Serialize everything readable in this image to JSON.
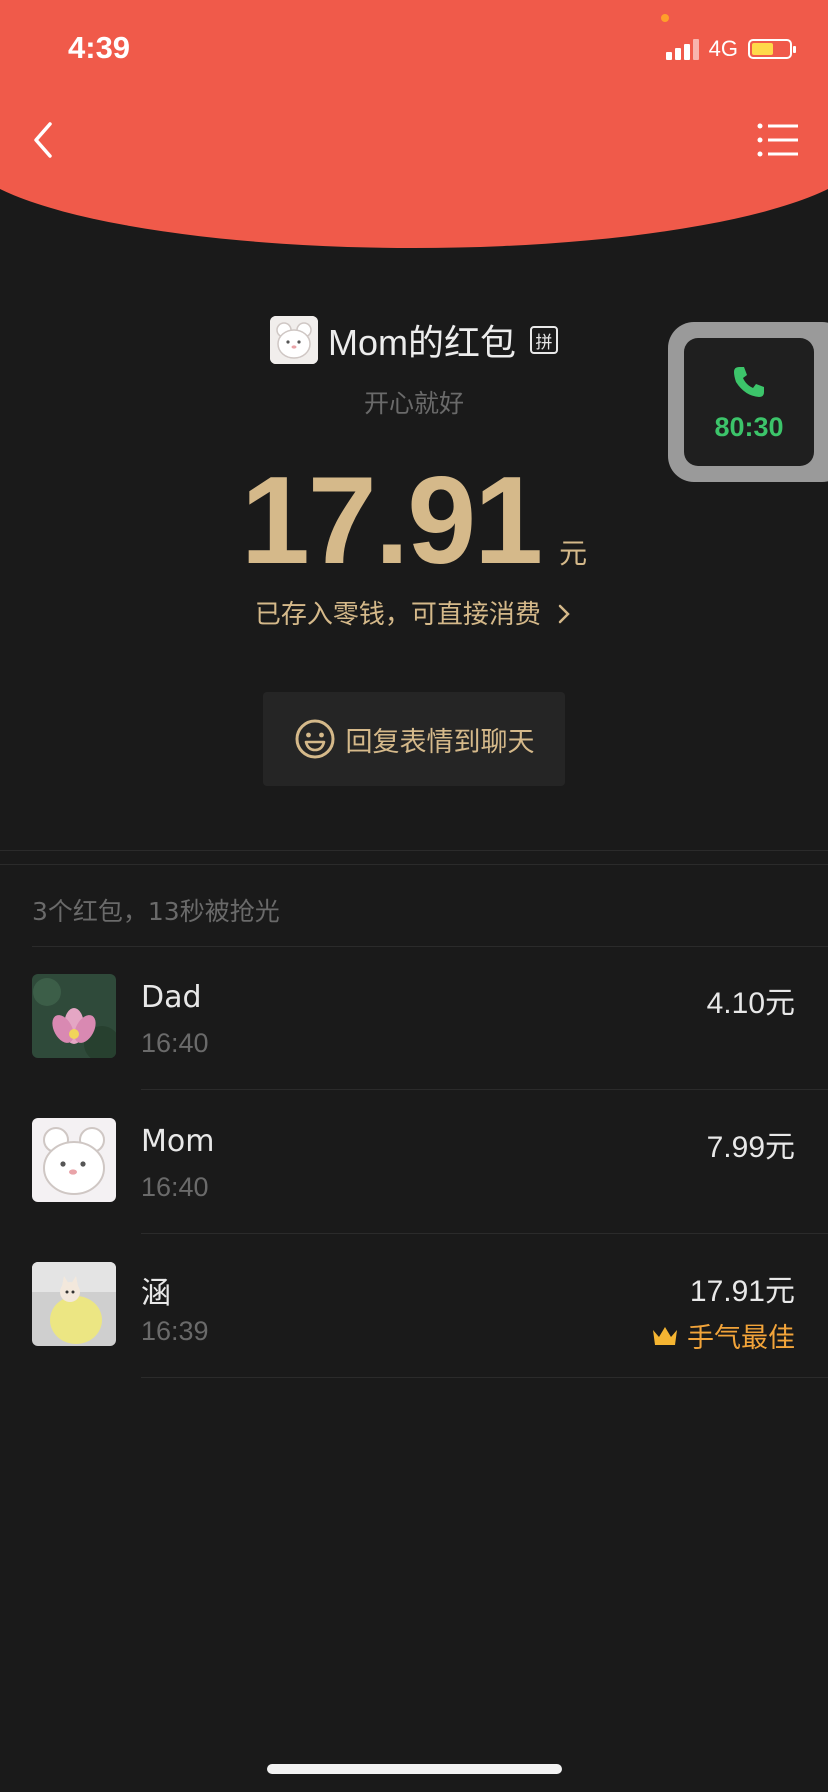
{
  "status": {
    "time": "4:39",
    "network": "4G",
    "battery_level": 0.52
  },
  "nav": {
    "back_icon": "chevron-left-icon",
    "menu_icon": "list-icon"
  },
  "packet": {
    "sender": "Mom的红包",
    "type_badge": "拼",
    "greeting": "开心就好",
    "amount": "17.91",
    "unit": "元",
    "saved_note": "已存入零钱，可直接消费",
    "reply_label": "回复表情到聊天"
  },
  "call_widget": {
    "duration": "80:30",
    "icon": "phone-icon",
    "color": "#3cc46a"
  },
  "summary": "3个红包，13秒被抢光",
  "recipients": [
    {
      "name": "Dad",
      "time": "16:40",
      "amount": "4.10元",
      "avatar": "lotus"
    },
    {
      "name": "Mom",
      "time": "16:40",
      "amount": "7.99元",
      "avatar": "bear"
    },
    {
      "name": "涵",
      "time": "16:39",
      "amount": "17.91元",
      "avatar": "cat",
      "badge": "手气最佳"
    }
  ],
  "colors": {
    "header_red": "#f05a4a",
    "gold": "#d5b98a",
    "best_luck": "#f2a43a",
    "background": "#1a1a1a"
  }
}
